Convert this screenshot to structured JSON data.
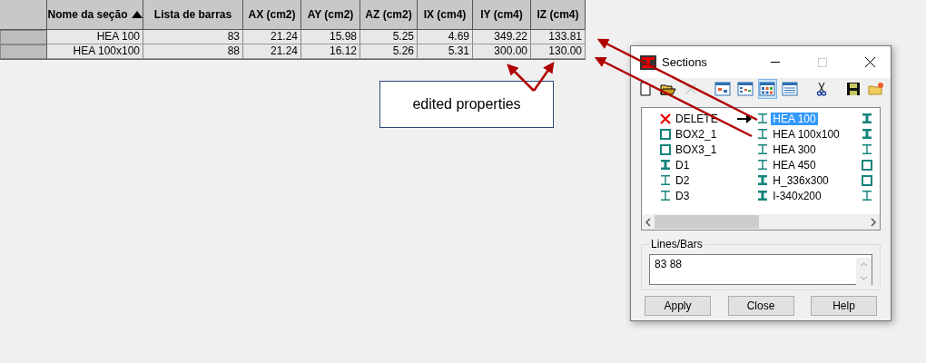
{
  "table": {
    "columns": [
      {
        "label": "Nome da seção",
        "sorted": true
      },
      {
        "label": "Lista de barras",
        "sorted": false
      },
      {
        "label": "AX (cm2)",
        "sorted": false
      },
      {
        "label": "AY (cm2)",
        "sorted": false
      },
      {
        "label": "AZ (cm2)",
        "sorted": false
      },
      {
        "label": "IX (cm4)",
        "sorted": false
      },
      {
        "label": "IY (cm4)",
        "sorted": false
      },
      {
        "label": "IZ (cm4)",
        "sorted": false
      }
    ],
    "rows": [
      {
        "cells": [
          "HEA 100",
          "83",
          "21.24",
          "15.98",
          "5.25",
          "4.69",
          "349.22",
          "133.81"
        ]
      },
      {
        "cells": [
          "HEA 100x100",
          "88",
          "21.24",
          "16.12",
          "5.26",
          "5.31",
          "300.00",
          "130.00"
        ]
      }
    ]
  },
  "annotation": {
    "text": "edited properties"
  },
  "dialog": {
    "title": "Sections",
    "toolbar": [
      {
        "kind": "new",
        "pressed": false,
        "disabled": false
      },
      {
        "kind": "open",
        "pressed": false,
        "disabled": false
      },
      {
        "kind": "delete",
        "pressed": false,
        "disabled": true
      },
      {
        "kind": "view1",
        "pressed": false,
        "disabled": false
      },
      {
        "kind": "view2",
        "pressed": false,
        "disabled": false
      },
      {
        "kind": "view3",
        "pressed": true,
        "disabled": false
      },
      {
        "kind": "view4",
        "pressed": false,
        "disabled": false
      },
      {
        "kind": "cut",
        "pressed": false,
        "disabled": false
      },
      {
        "kind": "save",
        "pressed": false,
        "disabled": false
      },
      {
        "kind": "folder",
        "pressed": false,
        "disabled": false
      }
    ],
    "list_columns": [
      [
        {
          "label": "DELETE",
          "kind": "delete",
          "selected": false,
          "current": false
        },
        {
          "label": "BOX2_1",
          "kind": "box",
          "selected": false,
          "current": false
        },
        {
          "label": "BOX3_1",
          "kind": "box",
          "selected": false,
          "current": false
        },
        {
          "label": "D1",
          "kind": "ibeam_bold",
          "selected": false,
          "current": false
        },
        {
          "label": "D2",
          "kind": "ibeam",
          "selected": false,
          "current": false
        },
        {
          "label": "D3",
          "kind": "ibeam",
          "selected": false,
          "current": false
        }
      ],
      [
        {
          "label": "HEA 100",
          "kind": "ibeam",
          "selected": true,
          "current": true
        },
        {
          "label": "HEA 100x100",
          "kind": "ibeam",
          "selected": false,
          "current": false
        },
        {
          "label": "HEA 300",
          "kind": "ibeam",
          "selected": false,
          "current": false
        },
        {
          "label": "HEA 450",
          "kind": "ibeam",
          "selected": false,
          "current": false
        },
        {
          "label": "H_336x300",
          "kind": "ibeam_bold",
          "selected": false,
          "current": false
        },
        {
          "label": "I-340x200",
          "kind": "ibeam_bold",
          "selected": false,
          "current": false
        }
      ],
      [
        {
          "kind": "ibeam_bold"
        },
        {
          "kind": "ibeam_bold"
        },
        {
          "kind": "ibeam"
        },
        {
          "kind": "box"
        },
        {
          "kind": "box"
        },
        {
          "kind": "ibeam"
        }
      ]
    ],
    "group_label": "Lines/Bars",
    "lines_value": "83 88",
    "buttons": [
      "Apply",
      "Close",
      "Help"
    ]
  }
}
